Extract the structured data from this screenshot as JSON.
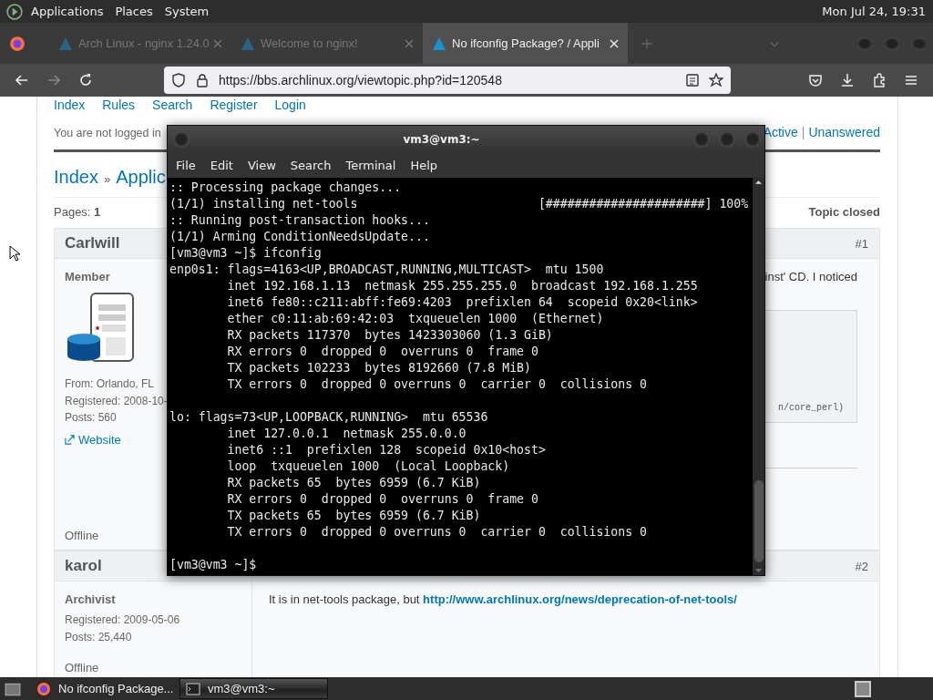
{
  "top_panel": {
    "menus": [
      "Applications",
      "Places",
      "System"
    ],
    "clock": "Mon Jul 24, 19:31"
  },
  "browser": {
    "tabs": [
      {
        "title": "Arch Linux - nginx 1.24.0",
        "selected": false
      },
      {
        "title": "Welcome to nginx!",
        "selected": false
      },
      {
        "title": "No ifconfig Package? / Appli",
        "selected": true
      }
    ],
    "url": "https://bbs.archlinux.org/viewtopic.php?id=120548",
    "page": {
      "nav_links": [
        "Index",
        "Rules",
        "Search",
        "Register",
        "Login"
      ],
      "login_status": "You are not logged in",
      "topic_links": [
        "Active",
        "Unanswered"
      ],
      "topic_links_separator": "|",
      "breadcrumb": [
        "Index",
        "Applic"
      ],
      "breadcrumb_separator": "»",
      "pages_label": "Pages:",
      "page_number": "1",
      "topic_status": "Topic closed",
      "posts": [
        {
          "kind": "partial",
          "author": "Carlwill",
          "number": "#1",
          "rank": "Member",
          "avatar": true,
          "info": [
            "From: Orlando, FL",
            "Registered: 2008-10-",
            "Posts: 560"
          ],
          "website": "Website",
          "status": "Offline",
          "text": "inst' CD. I noticed",
          "code_tail": "n/core_perl)"
        },
        {
          "kind": "full",
          "author": "karol",
          "number": "#2",
          "rank": "Archivist",
          "avatar": false,
          "info": [
            "Registered: 2009-05-06",
            "Posts: 25,440"
          ],
          "status": "Offline",
          "text": "It is in net-tools package, but ",
          "link": "http://www.archlinux.org/news/deprecation-of-net-tools/"
        }
      ]
    }
  },
  "terminal": {
    "title": "vm3@vm3:~",
    "menu": [
      "File",
      "Edit",
      "View",
      "Search",
      "Terminal",
      "Help"
    ],
    "blocks": [
      [
        ":: Processing package changes...",
        "(1/1) installing net-tools                         [######################] 100%",
        ":: Running post-transaction hooks...",
        "(1/1) Arming ConditionNeedsUpdate...",
        "[vm3@vm3 ~]$ ifconfig",
        "enp0s1: flags=4163<UP,BROADCAST,RUNNING,MULTICAST>  mtu 1500",
        "        inet 192.168.1.13  netmask 255.255.255.0  broadcast 192.168.1.255",
        "        inet6 fe80::c211:abff:fe69:4203  prefixlen 64  scopeid 0x20<link>",
        "        ether c0:11:ab:69:42:03  txqueuelen 1000  (Ethernet)",
        "        RX packets 117370  bytes 1423303060 (1.3 GiB)",
        "        RX errors 0  dropped 0  overruns 0  frame 0",
        "        TX packets 102233  bytes 8192660 (7.8 MiB)",
        "        TX errors 0  dropped 0 overruns 0  carrier 0  collisions 0"
      ],
      [
        "lo: flags=73<UP,LOOPBACK,RUNNING>  mtu 65536",
        "        inet 127.0.0.1  netmask 255.0.0.0",
        "        inet6 ::1  prefixlen 128  scopeid 0x10<host>",
        "        loop  txqueuelen 1000  (Local Loopback)",
        "        RX packets 65  bytes 6959 (6.7 KiB)",
        "        RX errors 0  dropped 0  overruns 0  frame 0",
        "        TX packets 65  bytes 6959 (6.7 KiB)",
        "        TX errors 0  dropped 0 overruns 0  carrier 0  collisions 0"
      ],
      [
        "[vm3@vm3 ~]$ "
      ]
    ]
  },
  "taskbar": {
    "items": [
      {
        "kind": "browser",
        "label": "No ifconfig Package...",
        "selected": false
      },
      {
        "kind": "terminal",
        "label": "vm3@vm3:~",
        "selected": true
      }
    ]
  }
}
